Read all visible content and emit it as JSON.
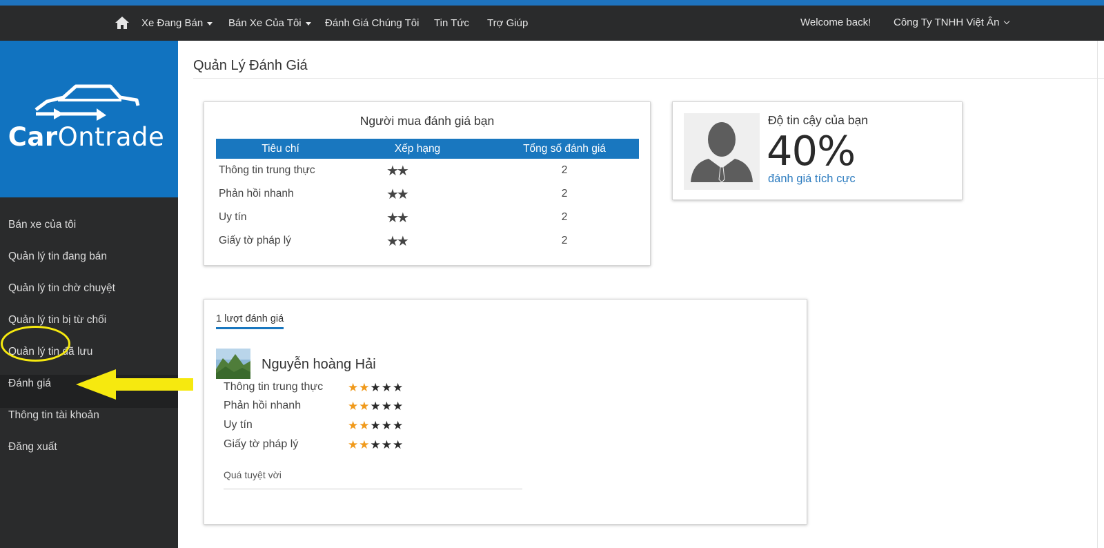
{
  "navbar": {
    "items": [
      {
        "label": "Xe Đang Bán",
        "dropdown": true
      },
      {
        "label": "Bán Xe Của Tôi",
        "dropdown": true
      },
      {
        "label": "Đánh Giá Chúng Tôi"
      },
      {
        "label": "Tin Tức"
      },
      {
        "label": "Trợ Giúp"
      }
    ],
    "welcome": "Welcome back!",
    "account": "Công Ty TNHH Việt Ân"
  },
  "logo": {
    "bold": "Car",
    "rest": "Ontrade"
  },
  "sidebar": {
    "items": [
      {
        "label": "Bán xe của tôi"
      },
      {
        "label": "Quản lý tin đang bán"
      },
      {
        "label": "Quản lý tin chờ chuyệt"
      },
      {
        "label": "Quản lý tin bị từ chối"
      },
      {
        "label": "Quản lý tin đã lưu"
      },
      {
        "label": "Đánh giá",
        "active": true
      },
      {
        "label": "Thông tin tài khoản"
      },
      {
        "label": "Đăng xuất"
      }
    ]
  },
  "page": {
    "title": "Quản Lý Đánh Giá"
  },
  "summary": {
    "title": "Người mua đánh giá bạn",
    "headers": [
      "Tiêu chí",
      "Xếp hạng",
      "Tổng số đánh giá"
    ],
    "rows": [
      {
        "criterion": "Thông tin trung thực",
        "stars": 2,
        "total": "2"
      },
      {
        "criterion": "Phản hồi nhanh",
        "stars": 2,
        "total": "2"
      },
      {
        "criterion": "Uy tín",
        "stars": 2,
        "total": "2"
      },
      {
        "criterion": "Giấy tờ pháp lý",
        "stars": 2,
        "total": "2"
      }
    ]
  },
  "trust": {
    "label": "Độ tin cậy của bạn",
    "value": "40%",
    "caption": "đánh giá tích cực"
  },
  "reviews": {
    "count_label": "1 lượt đánh giá",
    "items": [
      {
        "reviewer": "Nguyễn hoàng Hải",
        "criteria": [
          {
            "label": "Thông tin trung thực",
            "rating": 2,
            "max": 5
          },
          {
            "label": "Phản hồi nhanh",
            "rating": 2,
            "max": 5
          },
          {
            "label": "Uy tín",
            "rating": 2,
            "max": 5
          },
          {
            "label": "Giấy tờ pháp lý",
            "rating": 2,
            "max": 5
          }
        ],
        "comment": "Quá tuyệt vời"
      }
    ]
  },
  "colors": {
    "brand_blue": "#1173c0",
    "table_header": "#1977bf",
    "star_gold": "#f4b20f",
    "star_orange": "#f09a1c",
    "highlight_yellow": "#f6e90f",
    "dark_bg": "#2a2b2c"
  },
  "icons": {
    "home": "home-icon",
    "star": "star-icon",
    "avatar": "user-silhouette-icon"
  }
}
